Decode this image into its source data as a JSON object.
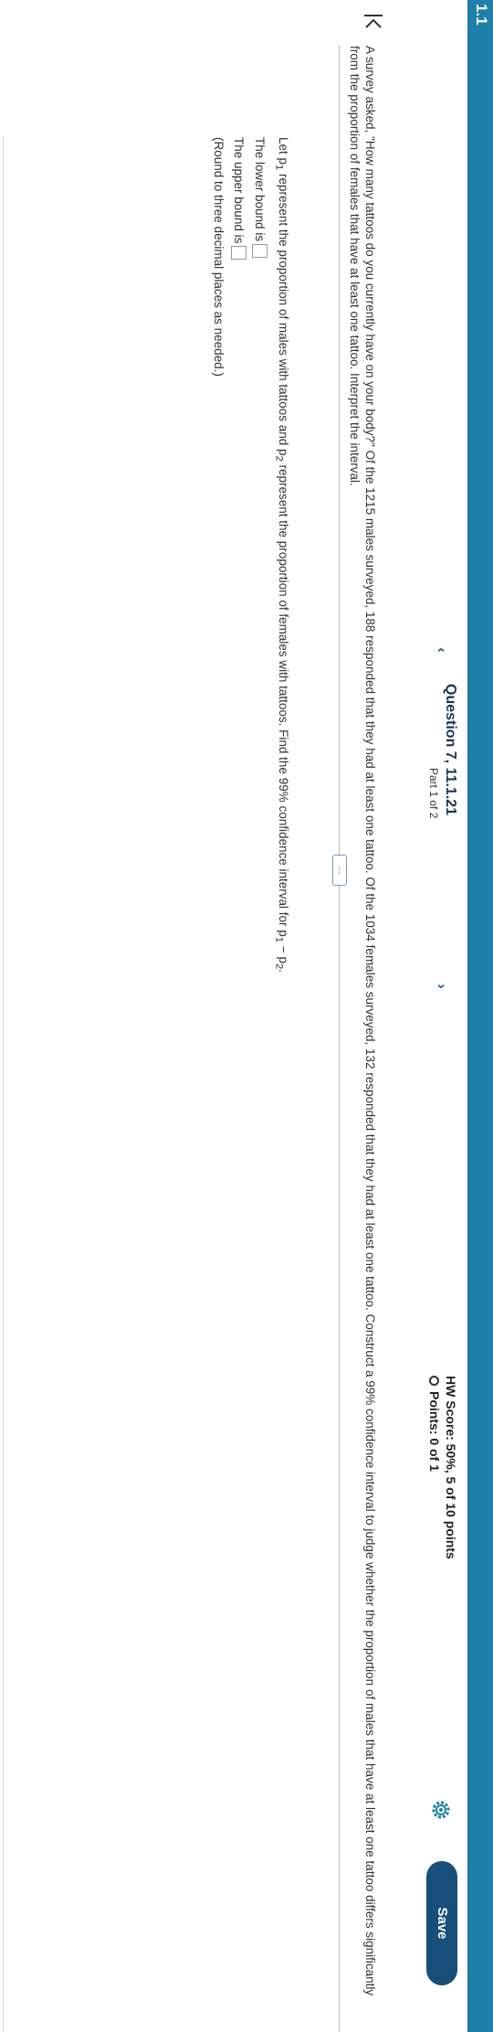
{
  "topbar": {
    "label": "1.1"
  },
  "header": {
    "prev_glyph": "‹",
    "next_glyph": "›",
    "question_title": "Question 7, 11.1.21",
    "part": "Part 1 of 2",
    "hw_score": "HW Score: 50%, 5 of 10 points",
    "points": "Points: 0 of 1",
    "save_label": "Save"
  },
  "problem_text": "A survey asked, \"How many tattoos do you currently have on your body?\" Of the 1215 males surveyed, 188 responded that they had at least one tattoo. Of the 1034 females surveyed, 132 responded that they had at least one tattoo. Construct a 99% confidence interval to judge whether the proportion of males that have at least one tattoo differs significantly from the proportion of females that have at least one tattoo. Interpret the interval.",
  "more_label": "...",
  "instructions": {
    "prefix": "Let p",
    "sub1": "1",
    "mid1": " represent the proportion of males with tattoos and p",
    "sub2": "2",
    "mid2": " represent the proportion of females with tattoos. Find the 99% confidence interval for p",
    "sub3": "1",
    "mid3": " − p",
    "sub4": "2",
    "suffix": "."
  },
  "answers": {
    "lower_label": "The lower bound is",
    "upper_label": "The upper bound is",
    "round_note": "(Round to three decimal places as needed.)"
  },
  "colors": {
    "topbar": "#1e7fa8",
    "save_button": "#174f7a",
    "title_text": "#1a3552"
  }
}
